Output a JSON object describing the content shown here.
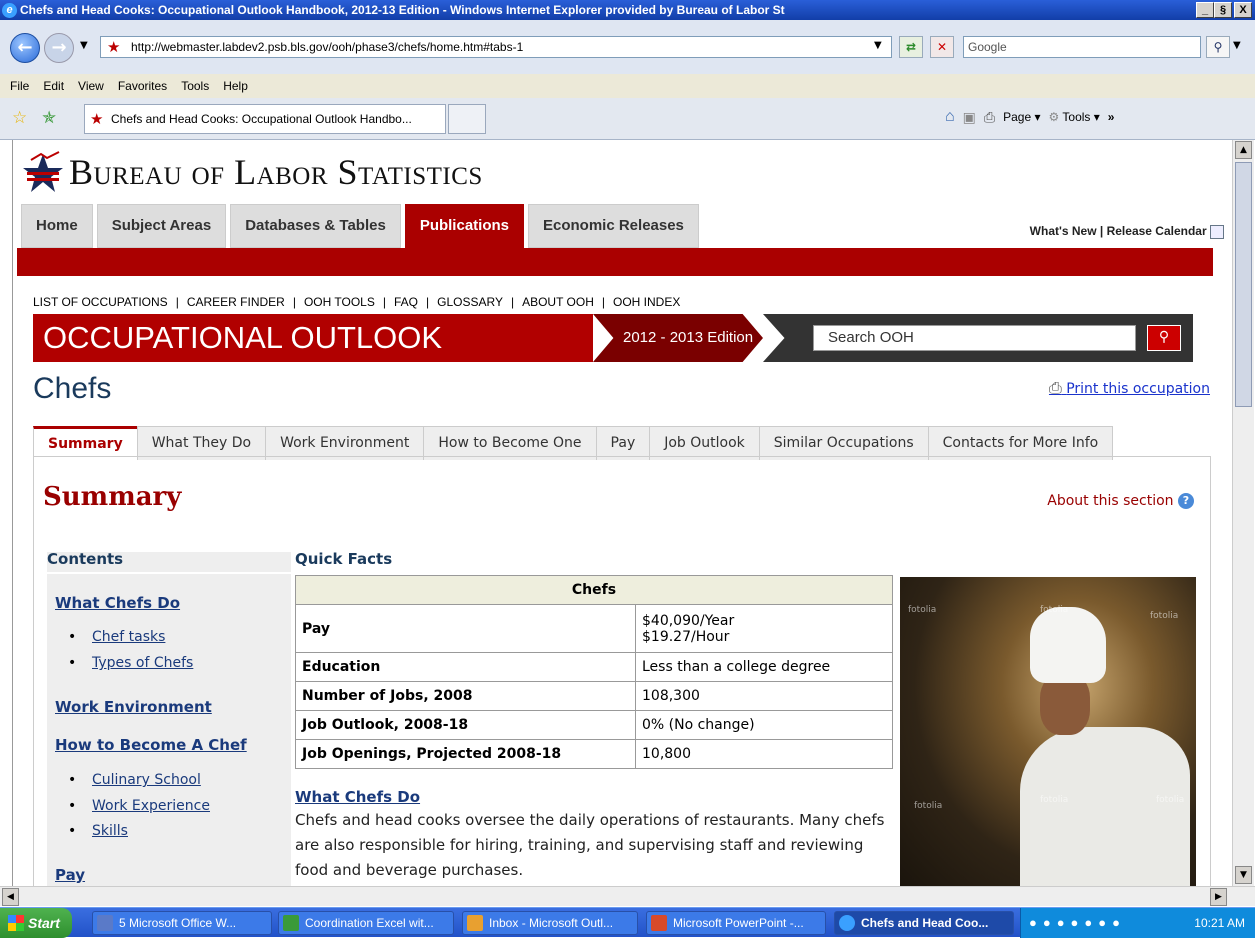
{
  "window": {
    "title": "Chefs and Head Cooks: Occupational Outlook Handbook, 2012-13 Edition - Windows Internet Explorer provided by Bureau of Labor St",
    "minimize": "_",
    "restore": "§",
    "close": "X"
  },
  "browser": {
    "url": "http://webmaster.labdev2.psb.bls.gov/ooh/phase3/chefs/home.htm#tabs-1",
    "search_placeholder": "Google",
    "menu": [
      "File",
      "Edit",
      "View",
      "Favorites",
      "Tools",
      "Help"
    ],
    "tab_title": "Chefs and Head Cooks: Occupational Outlook Handbo...",
    "cmd_page": "Page",
    "cmd_tools": "Tools"
  },
  "site": {
    "name": "Bureau of Labor Statistics",
    "nav": [
      "Home",
      "Subject Areas",
      "Databases & Tables",
      "Publications",
      "Economic Releases"
    ],
    "active_nav": "Publications",
    "whats_new": "What's New",
    "separator": "|",
    "release_calendar": "Release Calendar"
  },
  "ooh": {
    "links": [
      "LIST OF OCCUPATIONS",
      "|",
      "CAREER FINDER",
      "|",
      "OOH TOOLS",
      "|",
      "FAQ",
      "|",
      "GLOSSARY",
      "|",
      "ABOUT OOH",
      "|",
      "OOH INDEX"
    ],
    "title": "OCCUPATIONAL OUTLOOK HANDBOOK",
    "edition": "2012 - 2013 Edition",
    "search_placeholder": "Search OOH"
  },
  "page": {
    "occupation": "Chefs",
    "print_link": "Print this occupation",
    "tabs": [
      "Summary",
      "What They Do",
      "Work Environment",
      "How to Become One",
      "Pay",
      "Job Outlook",
      "Similar Occupations",
      "Contacts for More Info"
    ],
    "active_tab": "Summary",
    "section_title": "Summary",
    "about_section": "About this section"
  },
  "contents": {
    "heading": "Contents",
    "items": {
      "what_chefs_do": "What Chefs Do",
      "chef_tasks": "Chef tasks",
      "types_of_chefs": "Types of Chefs",
      "work_environment": "Work Environment",
      "how_to_become": "How to Become A Chef",
      "culinary_school": "Culinary School",
      "work_experience": "Work Experience",
      "skills": "Skills",
      "pay": "Pay"
    }
  },
  "quick_facts": {
    "heading": "Quick Facts",
    "table_title": "Chefs",
    "rows": [
      {
        "label": "Pay",
        "value": "$40,090/Year",
        "value2": "$19.27/Hour"
      },
      {
        "label": "Education",
        "value": "Less than a college degree"
      },
      {
        "label": "Number of Jobs, 2008",
        "value": "108,300"
      },
      {
        "label": "Job Outlook, 2008-18",
        "value": "0% (No change)"
      },
      {
        "label": "Job Openings, Projected 2008-18",
        "value": "10,800"
      }
    ]
  },
  "photo_watermark": "fotolia",
  "what_chefs_do": {
    "heading": "What Chefs Do",
    "body": "Chefs and head cooks oversee the daily operations of restaurants. Many chefs are also responsible for hiring, training, and supervising staff and reviewing food and beverage purchases."
  },
  "taskbar": {
    "start": "Start",
    "items": [
      "5 Microsoft Office W...",
      "Coordination Excel wit...",
      "Inbox - Microsoft Outl...",
      "Microsoft PowerPoint -...",
      "Chefs and Head Coo..."
    ],
    "clock": "10:21 AM"
  }
}
